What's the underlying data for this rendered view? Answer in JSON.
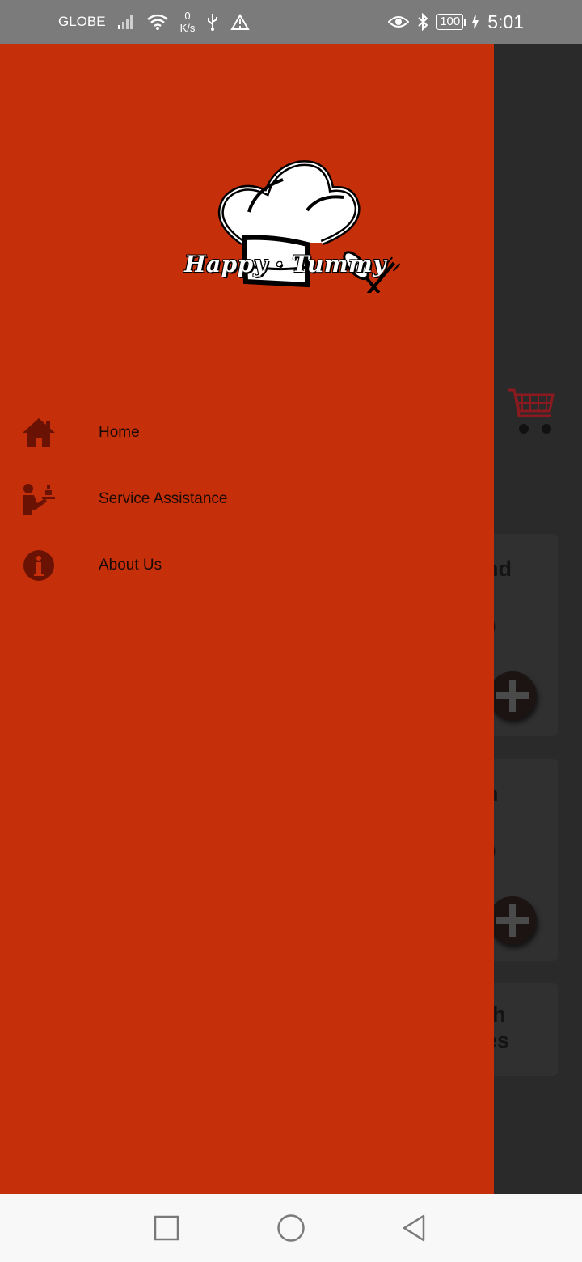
{
  "status_bar": {
    "carrier": "GLOBE",
    "speed_value": "0",
    "speed_unit": "K/s",
    "battery": "100",
    "time": "5:01",
    "icons": [
      "signal-icon",
      "wifi-icon",
      "usb-icon",
      "warning-icon",
      "eye-icon",
      "bluetooth-icon",
      "charging-icon"
    ]
  },
  "drawer": {
    "logo_text": "Happy · Tummy",
    "menu": [
      {
        "label": "Home",
        "icon": "home-icon"
      },
      {
        "label": "Service Assistance",
        "icon": "waiter-icon"
      },
      {
        "label": "About Us",
        "icon": "info-icon"
      }
    ],
    "accent_color": "#c52f09",
    "icon_color": "#6a1204"
  },
  "background": {
    "cards": [
      {
        "title_fragment": "nd",
        "price_fragment": "0"
      },
      {
        "title_fragment": "h",
        "price_fragment": "0"
      },
      {
        "title_fragment": "th\nes"
      }
    ]
  },
  "nav_bar": {
    "buttons": [
      "recent-apps-button",
      "home-button",
      "back-button"
    ]
  }
}
